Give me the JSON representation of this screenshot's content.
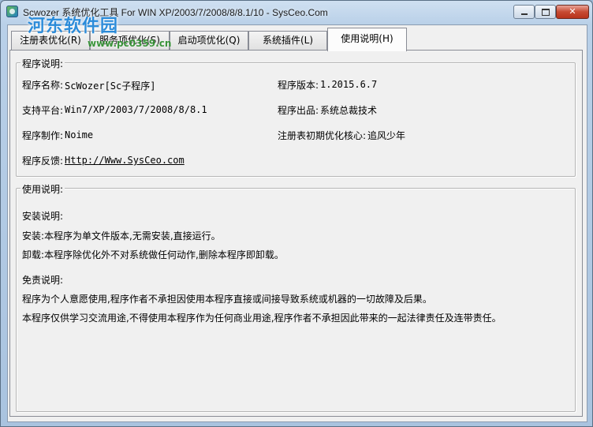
{
  "window": {
    "title": "Scwozer 系统优化工具 For WIN XP/2003/7/2008/8/8.1/10 - SysCeo.Com",
    "controls": {
      "close": "✕"
    }
  },
  "watermark": {
    "name": "河东软件园",
    "url": "www.pc0359.cn"
  },
  "tabs": [
    {
      "label": "注册表优化(R)"
    },
    {
      "label": "服务项优化(S)"
    },
    {
      "label": "启动项优化(Q)"
    },
    {
      "label": "系统插件(L)"
    },
    {
      "label": "使用说明(H)",
      "active": true
    }
  ],
  "program_info": {
    "group_title": "程序说明:",
    "name_label": "程序名称:",
    "name_value": "ScWozer[Sc子程序]",
    "version_label": "程序版本:",
    "version_value": "1.2015.6.7",
    "platform_label": "支持平台:",
    "platform_value": "Win7/XP/2003/7/2008/8/8.1",
    "publisher_label": "程序出品:",
    "publisher_value": "系统总裁技术",
    "author_label": "程序制作:",
    "author_value": "Noime",
    "core_label": "注册表初期优化核心:",
    "core_value": "追风少年",
    "feedback_label": "程序反馈:",
    "feedback_link": "Http://Www.SysCeo.com"
  },
  "usage": {
    "group_title": "使用说明:",
    "install_heading": "安装说明:",
    "install_line": "安装:本程序为单文件版本,无需安装,直接运行。",
    "uninstall_line": "卸载:本程序除优化外不对系统做任何动作,删除本程序即卸载。",
    "disclaimer_heading": "免责说明:",
    "disclaimer_line1": "程序为个人意愿使用,程序作者不承担因使用本程序直接或间接导致系统或机器的一切故障及后果。",
    "disclaimer_line2": "本程序仅供学习交流用途,不得使用本程序作为任何商业用途,程序作者不承担因此带来的一起法律责任及连带责任。"
  },
  "colors": {
    "watermark": "#1f86d9",
    "watermark_url": "#2a8d2a",
    "close_button": "#c74a32"
  }
}
